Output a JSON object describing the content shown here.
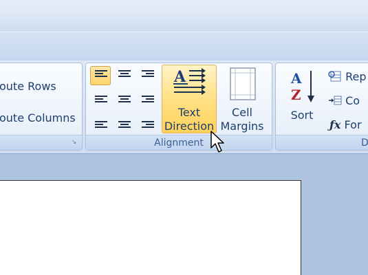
{
  "ribbon": {
    "cell_size_group": {
      "distribute_rows_label": "oute Rows",
      "distribute_columns_label": "oute Columns",
      "launcher_icon": "dialog-launcher-icon"
    },
    "alignment_group": {
      "label": "Alignment",
      "buttons": [
        {
          "name": "align-top-left",
          "selected": true
        },
        {
          "name": "align-top-center",
          "selected": false
        },
        {
          "name": "align-top-right",
          "selected": false
        },
        {
          "name": "align-center-left",
          "selected": false
        },
        {
          "name": "align-center",
          "selected": false
        },
        {
          "name": "align-center-right",
          "selected": false
        },
        {
          "name": "align-bottom-left",
          "selected": false
        },
        {
          "name": "align-bottom-center",
          "selected": false
        },
        {
          "name": "align-bottom-right",
          "selected": false
        }
      ],
      "text_direction": {
        "line1": "Text",
        "line2": "Direction",
        "icon": "text-direction-icon"
      },
      "cell_margins": {
        "line1": "Cell",
        "line2": "Margins",
        "icon": "cell-margins-icon"
      }
    },
    "data_group": {
      "label": "D",
      "sort_label": "Sort",
      "sort_icon": "sort-az-icon",
      "items": [
        {
          "label": "Rep",
          "icon": "repeat-header-rows-icon"
        },
        {
          "label": "Co",
          "icon": "convert-to-text-icon"
        },
        {
          "label": "For",
          "icon": "formula-icon"
        }
      ]
    }
  },
  "colors": {
    "accent_hover": "#ffd15a",
    "ribbon_text": "#1e3f6e",
    "group_label": "#3b5f95"
  }
}
